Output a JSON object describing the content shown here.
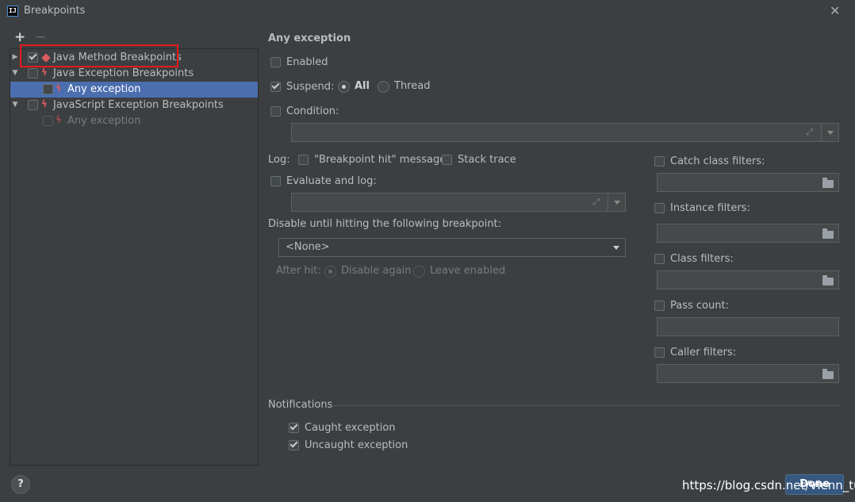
{
  "window": {
    "title": "Breakpoints",
    "app_icon_text": "IJ"
  },
  "toolbar": {
    "add_icon": "+",
    "remove_icon": "−"
  },
  "tree": {
    "items": [
      {
        "label": "Java Method Breakpoints",
        "checked": true
      },
      {
        "label": "Java Exception Breakpoints",
        "checked": false
      },
      {
        "label": "Any exception",
        "checked": false,
        "selected": true
      },
      {
        "label": "JavaScript Exception Breakpoints",
        "checked": false
      },
      {
        "label": "Any exception",
        "checked": false,
        "disabled": true
      }
    ]
  },
  "details": {
    "title": "Any exception",
    "enabled_label": "Enabled",
    "suspend_label": "Suspend:",
    "suspend_all_label": "All",
    "suspend_thread_label": "Thread",
    "condition_label": "Condition:",
    "log_label": "Log:",
    "log_message_label": "\"Breakpoint hit\" message",
    "stack_trace_label": "Stack trace",
    "evaluate_label": "Evaluate and log:",
    "disable_until_label": "Disable until hitting the following breakpoint:",
    "disable_until_value": "<None>",
    "after_hit_label": "After hit:",
    "disable_again_label": "Disable again",
    "leave_enabled_label": "Leave enabled"
  },
  "filters": {
    "catch_class": "Catch class filters:",
    "instance": "Instance filters:",
    "class": "Class filters:",
    "pass_count": "Pass count:",
    "caller": "Caller filters:"
  },
  "notifications": {
    "title": "Notifications",
    "caught_label": "Caught exception",
    "uncaught_label": "Uncaught exception"
  },
  "footer": {
    "help": "?",
    "done_label": "Done"
  },
  "watermark": "https://blog.csdn.net/Vienn_tu",
  "colors": {
    "selection": "#4b6eaf",
    "breakpoint_red": "#db5c5c",
    "highlight_box": "#e5191d",
    "done_button": "#365880"
  }
}
